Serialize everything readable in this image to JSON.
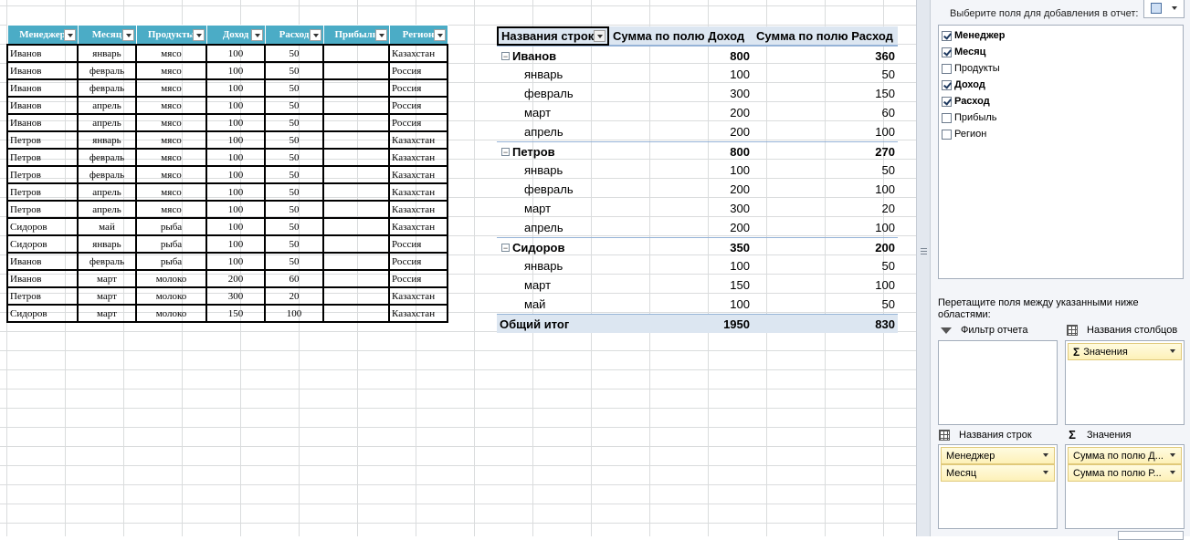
{
  "source_table": {
    "headers": [
      "Менеджер",
      "Месяц",
      "Продукты",
      "Доход",
      "Расход",
      "Прибыль",
      "Регион"
    ],
    "rows": [
      [
        "Иванов",
        "январь",
        "мясо",
        "100",
        "50",
        "",
        "Казахстан"
      ],
      [
        "Иванов",
        "февраль",
        "мясо",
        "100",
        "50",
        "",
        "Россия"
      ],
      [
        "Иванов",
        "февраль",
        "мясо",
        "100",
        "50",
        "",
        "Россия"
      ],
      [
        "Иванов",
        "апрель",
        "мясо",
        "100",
        "50",
        "",
        "Россия"
      ],
      [
        "Иванов",
        "апрель",
        "мясо",
        "100",
        "50",
        "",
        "Россия"
      ],
      [
        "Петров",
        "январь",
        "мясо",
        "100",
        "50",
        "",
        "Казахстан"
      ],
      [
        "Петров",
        "февраль",
        "мясо",
        "100",
        "50",
        "",
        "Казахстан"
      ],
      [
        "Петров",
        "февраль",
        "мясо",
        "100",
        "50",
        "",
        "Казахстан"
      ],
      [
        "Петров",
        "апрель",
        "мясо",
        "100",
        "50",
        "",
        "Казахстан"
      ],
      [
        "Петров",
        "апрель",
        "мясо",
        "100",
        "50",
        "",
        "Казахстан"
      ],
      [
        "Сидоров",
        "май",
        "рыба",
        "100",
        "50",
        "",
        "Казахстан"
      ],
      [
        "Сидоров",
        "январь",
        "рыба",
        "100",
        "50",
        "",
        "Россия"
      ],
      [
        "Иванов",
        "февраль",
        "рыба",
        "100",
        "50",
        "",
        "Россия"
      ],
      [
        "Иванов",
        "март",
        "молоко",
        "200",
        "60",
        "",
        "Россия"
      ],
      [
        "Петров",
        "март",
        "молоко",
        "300",
        "20",
        "",
        "Казахстан"
      ],
      [
        "Сидоров",
        "март",
        "молоко",
        "150",
        "100",
        "",
        "Казахстан"
      ]
    ]
  },
  "pivot": {
    "header": {
      "rows_label": "Названия строк",
      "col1": "Сумма по полю Доход",
      "col2": "Сумма по полю Расход"
    },
    "groups": [
      {
        "name": "Иванов",
        "income": "800",
        "expense": "360",
        "items": [
          {
            "label": "январь",
            "income": "100",
            "expense": "50"
          },
          {
            "label": "февраль",
            "income": "300",
            "expense": "150"
          },
          {
            "label": "март",
            "income": "200",
            "expense": "60"
          },
          {
            "label": "апрель",
            "income": "200",
            "expense": "100"
          }
        ]
      },
      {
        "name": "Петров",
        "income": "800",
        "expense": "270",
        "items": [
          {
            "label": "январь",
            "income": "100",
            "expense": "50"
          },
          {
            "label": "февраль",
            "income": "200",
            "expense": "100"
          },
          {
            "label": "март",
            "income": "300",
            "expense": "20"
          },
          {
            "label": "апрель",
            "income": "200",
            "expense": "100"
          }
        ]
      },
      {
        "name": "Сидоров",
        "income": "350",
        "expense": "200",
        "items": [
          {
            "label": "январь",
            "income": "100",
            "expense": "50"
          },
          {
            "label": "март",
            "income": "150",
            "expense": "100"
          },
          {
            "label": "май",
            "income": "100",
            "expense": "50"
          }
        ]
      }
    ],
    "total": {
      "label": "Общий итог",
      "income": "1950",
      "expense": "830"
    }
  },
  "field_list": {
    "title": "Выберите поля для добавления в отчет:",
    "fields": [
      {
        "name": "Менеджер",
        "checked": true
      },
      {
        "name": "Месяц",
        "checked": true
      },
      {
        "name": "Продукты",
        "checked": false
      },
      {
        "name": "Доход",
        "checked": true
      },
      {
        "name": "Расход",
        "checked": true
      },
      {
        "name": "Прибыль",
        "checked": false
      },
      {
        "name": "Регион",
        "checked": false
      }
    ],
    "drag_hint": "Перетащите поля между указанными ниже областями:",
    "areas": {
      "filter": {
        "label": "Фильтр отчета",
        "items": []
      },
      "columns": {
        "label": "Названия столбцов",
        "items": [
          "Значения"
        ]
      },
      "rows": {
        "label": "Названия строк",
        "items": [
          "Менеджер",
          "Месяц"
        ]
      },
      "values": {
        "label": "Значения",
        "items": [
          "Сумма по полю Д...",
          "Сумма по полю Р..."
        ]
      }
    },
    "icons": {
      "layout": "layout-icon",
      "filter": "filter-icon",
      "table": "table-icon",
      "sigma": "sigma-icon"
    }
  }
}
